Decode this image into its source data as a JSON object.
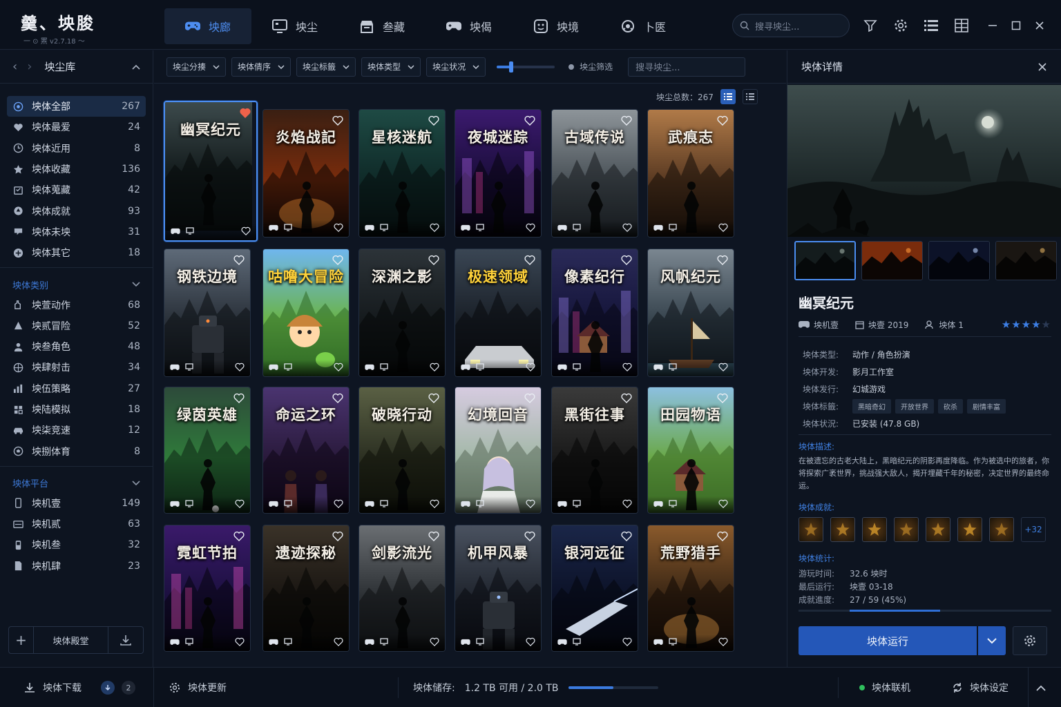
{
  "app": {
    "title": "羹、坱朘",
    "version": "一 ⊙ 罴 v2.7.18 ～"
  },
  "nav": {
    "tabs": [
      {
        "label": "坱廊",
        "icon": "gamepad-icon",
        "active": true
      },
      {
        "label": "坱尘",
        "icon": "monitor-icon"
      },
      {
        "label": "叁藏",
        "icon": "store-icon"
      },
      {
        "label": "坱偈",
        "icon": "controller-icon"
      },
      {
        "label": "坱境",
        "icon": "face-icon"
      },
      {
        "label": "卜匧",
        "icon": "headset-icon"
      }
    ]
  },
  "top": {
    "search_placeholder": "搜寻坱尘..."
  },
  "sidebar": {
    "title": "坱尘库",
    "library": [
      {
        "label": "坱体全部",
        "count": "267",
        "icon": "all-icon",
        "active": true
      },
      {
        "label": "坱体最爱",
        "count": "24",
        "icon": "heart-icon"
      },
      {
        "label": "坱体近用",
        "count": "8",
        "icon": "clock-icon"
      },
      {
        "label": "坱体收藏",
        "count": "136",
        "icon": "star-icon"
      },
      {
        "label": "坱体蒐藏",
        "count": "42",
        "icon": "box-icon"
      },
      {
        "label": "坱体成就",
        "count": "93",
        "icon": "trophy-icon"
      },
      {
        "label": "坱体未坱",
        "count": "31",
        "icon": "pending-icon"
      },
      {
        "label": "坱体其它",
        "count": "18",
        "icon": "plus-circle-icon"
      }
    ],
    "categories_title": "坱体类别",
    "categories": [
      {
        "label": "坱萱动作",
        "count": "68",
        "icon": "action-icon"
      },
      {
        "label": "坱贰冒险",
        "count": "52",
        "icon": "adventure-icon"
      },
      {
        "label": "坱叁角色",
        "count": "48",
        "icon": "role-icon"
      },
      {
        "label": "坱肆射击",
        "count": "34",
        "icon": "target-icon"
      },
      {
        "label": "坱伍策略",
        "count": "27",
        "icon": "strategy-icon"
      },
      {
        "label": "坱陆模拟",
        "count": "18",
        "icon": "sim-icon"
      },
      {
        "label": "坱柒竞速",
        "count": "12",
        "icon": "car-icon"
      },
      {
        "label": "坱捌体育",
        "count": "8",
        "icon": "ball-icon"
      }
    ],
    "platforms_title": "坱体平台",
    "platforms": [
      {
        "label": "坱机壹",
        "count": "149",
        "icon": "phone-icon"
      },
      {
        "label": "坱机贰",
        "count": "63",
        "icon": "console-icon"
      },
      {
        "label": "坱机叁",
        "count": "32",
        "icon": "handheld-icon"
      },
      {
        "label": "坱机肆",
        "count": "23",
        "icon": "doc-icon"
      }
    ],
    "hall_label": "坱体殿堂"
  },
  "filters": {
    "selects": [
      "坱尘分揍",
      "坱体倩序",
      "坱尘标籤",
      "坱体类型",
      "坱尘状况"
    ],
    "slider_value": 0.25,
    "toggle_label": "坱尘筛选",
    "search_placeholder": "搜寻坱尘..."
  },
  "count_text": "坱尘总数：267",
  "games": [
    {
      "title": "幽冥纪元",
      "art": "dark",
      "favorite": true,
      "selected": true
    },
    {
      "title": "炎焰战記",
      "art": "fire"
    },
    {
      "title": "星核迷航",
      "art": "teal"
    },
    {
      "title": "夜城迷踪",
      "art": "neon"
    },
    {
      "title": "古域传说",
      "art": "grey"
    },
    {
      "title": "武痕志",
      "art": "dusk"
    },
    {
      "title": "钢铁边境",
      "art": "mech"
    },
    {
      "title": "咕噜大冒险",
      "art": "cartoon",
      "yellow": true
    },
    {
      "title": "深渊之影",
      "art": "shadow"
    },
    {
      "title": "极速领域",
      "art": "race",
      "yellow": true
    },
    {
      "title": "像素纪行",
      "art": "pixel"
    },
    {
      "title": "风帆纪元",
      "art": "sea"
    },
    {
      "title": "绿茵英雄",
      "art": "soccer"
    },
    {
      "title": "命运之环",
      "art": "fate"
    },
    {
      "title": "破晓行动",
      "art": "war"
    },
    {
      "title": "幻境回音",
      "art": "anime"
    },
    {
      "title": "黑街往事",
      "art": "noir"
    },
    {
      "title": "田园物语",
      "art": "farm"
    },
    {
      "title": "霓虹节拍",
      "art": "neon2"
    },
    {
      "title": "遗迹探秘",
      "art": "ruin"
    },
    {
      "title": "剑影流光",
      "art": "sword"
    },
    {
      "title": "机甲风暴",
      "art": "robot"
    },
    {
      "title": "银河远征",
      "art": "space"
    },
    {
      "title": "荒野猎手",
      "art": "hunter"
    }
  ],
  "detail": {
    "header": "坱体详情",
    "name": "幽冥纪元",
    "platform": "坱机壹",
    "year": "坱壹 2019",
    "players": "坱体 1",
    "rating": 4,
    "rows": [
      {
        "k": "坱体类型:",
        "v": "动作 / 角色扮演"
      },
      {
        "k": "坱体开发:",
        "v": "影月工作室"
      },
      {
        "k": "坱体发行:",
        "v": "幻城游戏"
      }
    ],
    "tags_label": "坱体标籤:",
    "tags": [
      "黑暗奇幻",
      "开放世界",
      "砍杀",
      "剧情丰富"
    ],
    "status_label": "坱体状況:",
    "status": "已安装 (47.8 GB)",
    "desc_title": "坱体描述:",
    "desc": "在被遗忘的古老大陆上，黑暗纪元的阴影再度降临。作为被选中的旅者，你将探索广袤世界，挑战强大敌人，揭开埋藏千年的秘密，决定世界的最终命运。",
    "ach_title": "坱体成就:",
    "ach_more": "+32",
    "stats_title": "坱体统计:",
    "stats": [
      {
        "k": "游玩时间:",
        "v": "32.6 坱时"
      },
      {
        "k": "最后运行:",
        "v": "坱壹 03-18"
      },
      {
        "k": "成就進度:",
        "v": "27 / 59 (45%)"
      }
    ],
    "progress": 0.45,
    "run_label": "坱体运行"
  },
  "status": {
    "download": "坱体下载",
    "download_count": "2",
    "update": "坱体更新",
    "storage_label": "坱体储存:",
    "storage_value": "1.2 TB 可用 / 2.0 TB",
    "storage_used": 0.5,
    "online": "坱体联机",
    "settings": "坱体设定"
  },
  "colors": {
    "accent": "#3d7fe6",
    "bg": "#0e1522",
    "panel": "#0d1420"
  }
}
